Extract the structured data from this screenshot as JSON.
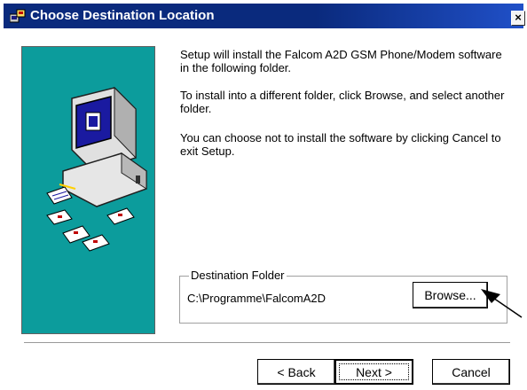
{
  "window": {
    "title": "Choose Destination Location",
    "close_glyph": "×",
    "title_bar_color": "#0a2a7d",
    "title_icon": "setup-installer-icon"
  },
  "illustration": {
    "background": "#0c9c9c",
    "icons": [
      "computer-monitor-icon",
      "floppy-disk-icon",
      "notepad-pen-icon"
    ]
  },
  "content": {
    "paragraph1": "Setup will install the Falcom A2D GSM Phone/Modem software in the following folder.",
    "paragraph2": "To install into a different folder, click Browse, and select another folder.",
    "paragraph3": "You can choose not to install the software by clicking Cancel to exit Setup."
  },
  "destination": {
    "legend": "Destination Folder",
    "path": "C:\\Programme\\FalcomA2D",
    "browse_label": "Browse..."
  },
  "buttons": {
    "back_label": "< Back",
    "next_label": "Next >",
    "cancel_label": "Cancel"
  }
}
